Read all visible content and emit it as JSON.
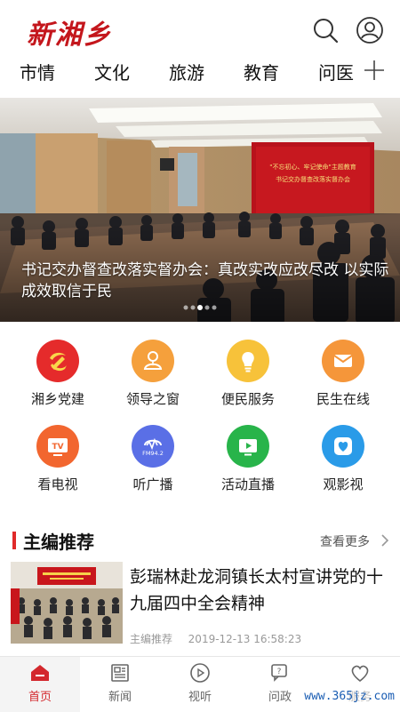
{
  "header": {
    "logo_text": "新湘乡",
    "search_icon": "search-icon",
    "user_icon": "user-icon"
  },
  "nav": {
    "items": [
      "市情",
      "文化",
      "旅游",
      "教育",
      "问医"
    ],
    "add_icon": "plus-icon"
  },
  "banner": {
    "caption": "书记交办督查改落实督办会：真改实改应改尽改 以实际成效取信于民",
    "screen_text_line1": "\"不忘初心、牢记使命\"主题教育",
    "screen_text_line2": "书记交办督查改落实督办会",
    "page_indicator": {
      "count": 5,
      "active": 2
    }
  },
  "grid": {
    "items": [
      {
        "label": "湘乡党建",
        "icon": "party-emblem-icon",
        "color": "#e52b2b"
      },
      {
        "label": "领导之窗",
        "icon": "person-icon",
        "color": "#f5a03c"
      },
      {
        "label": "便民服务",
        "icon": "lightbulb-icon",
        "color": "#f7c23a"
      },
      {
        "label": "民生在线",
        "icon": "mail-icon",
        "color": "#f5963a"
      },
      {
        "label": "看电视",
        "icon": "tv-icon",
        "color": "#f2662f"
      },
      {
        "label": "听广播",
        "icon": "radio-icon",
        "color": "#5a6fe6",
        "badge": "FM94.2"
      },
      {
        "label": "活动直播",
        "icon": "live-play-icon",
        "color": "#28b44a"
      },
      {
        "label": "观影视",
        "icon": "heart-film-icon",
        "color": "#2a9be8"
      }
    ]
  },
  "section": {
    "title": "主编推荐",
    "more_label": "查看更多"
  },
  "news": {
    "title": "彭瑞林赴龙洞镇长太村宣讲党的十九届四中全会精神",
    "category": "主编推荐",
    "timestamp": "2019-12-13 16:58:23"
  },
  "tabbar": {
    "items": [
      {
        "label": "首页",
        "icon": "home-icon",
        "active": true
      },
      {
        "label": "新闻",
        "icon": "newspaper-icon",
        "active": false
      },
      {
        "label": "视听",
        "icon": "play-circle-icon",
        "active": false
      },
      {
        "label": "问政",
        "icon": "question-chat-icon",
        "active": false
      },
      {
        "label": "服务",
        "icon": "heart-icon",
        "active": false
      }
    ]
  },
  "watermark": "www.365jz.com",
  "colors": {
    "brand": "#c4161c",
    "active_tab": "#d3282d",
    "section_bar": "#e02a2a"
  }
}
